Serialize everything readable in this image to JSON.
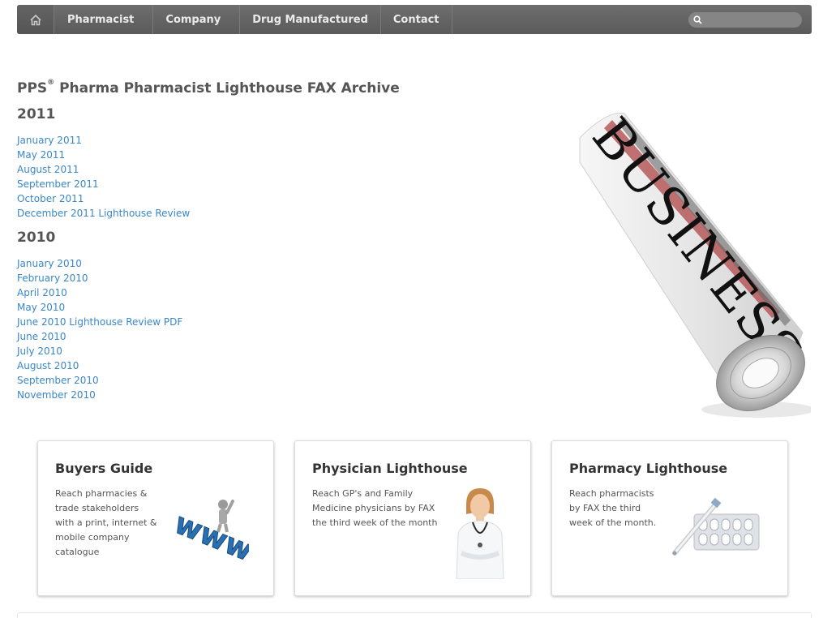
{
  "nav": {
    "home_icon": "home-icon",
    "items": [
      "Pharmacist",
      "Company",
      "Drug Manufactured",
      "Contact"
    ],
    "search_icon": "search-icon",
    "search_placeholder": ""
  },
  "archive": {
    "heading_prefix": "PPS",
    "heading_mark": "®",
    "heading_rest": " Pharma Pharmacist Lighthouse FAX Archive",
    "years": [
      {
        "year": "2011",
        "links": [
          "January 2011",
          "May 2011",
          "August 2011",
          "September 2011",
          "October 2011",
          "December 2011 Lighthouse Review"
        ]
      },
      {
        "year": "2010",
        "links": [
          "January 2010",
          "February 2010",
          "April 2010",
          "May 2010",
          "June 2010 Lighthouse Review PDF",
          "June 2010",
          "July 2010",
          "August 2010",
          "September 2010",
          "November 2010"
        ]
      }
    ]
  },
  "newspaper": {
    "masthead": "BUSINESS"
  },
  "cards": [
    {
      "title": "Buyers Guide",
      "lines": [
        "Reach pharmacies &",
        "trade stakeholders",
        "with a print, internet &",
        "mobile company",
        "catalogue"
      ],
      "art_text": "www"
    },
    {
      "title": "Physician Lighthouse",
      "lines": [
        "Reach GP's and Family",
        "Medicine physicians by FAX",
        "the third week of the month"
      ]
    },
    {
      "title": "Pharmacy Lighthouse",
      "lines": [
        "Reach pharmacists",
        "by FAX the third",
        "week of the month."
      ]
    }
  ],
  "colors": {
    "link": "#3a87c8",
    "nav_bg": "#636363",
    "www_blue": "#2a6fb0"
  }
}
